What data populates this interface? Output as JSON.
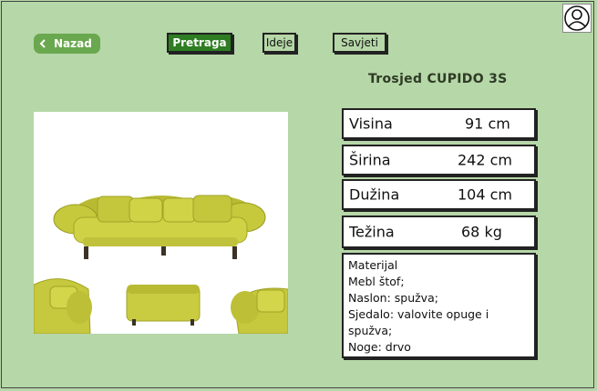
{
  "header": {
    "back_label": "Nazad",
    "nav": [
      {
        "label": "Pretraga",
        "active": true
      },
      {
        "label": "Ideje",
        "active": false
      },
      {
        "label": "Savjeti",
        "active": false
      }
    ],
    "avatar_icon": "user-avatar-icon"
  },
  "product": {
    "title": "Trosjed CUPIDO 3S",
    "specs": [
      {
        "label": "Visina",
        "value": "91 cm"
      },
      {
        "label": "Širina",
        "value": "242 cm"
      },
      {
        "label": "Dužina",
        "value": "104 cm"
      },
      {
        "label": "Težina",
        "value": "68 kg"
      }
    ],
    "material": {
      "heading": "Materijal",
      "lines": [
        "Mebl štof;",
        "Naslon: spužva;",
        "Sjedalo: valovite opuge i spužva;",
        "Noge: drvo"
      ]
    }
  },
  "colors": {
    "background": "#b6d7a8",
    "accent": "#6aa84f",
    "active_button": "#2e7d22",
    "sofa": "#c8cc3f"
  }
}
